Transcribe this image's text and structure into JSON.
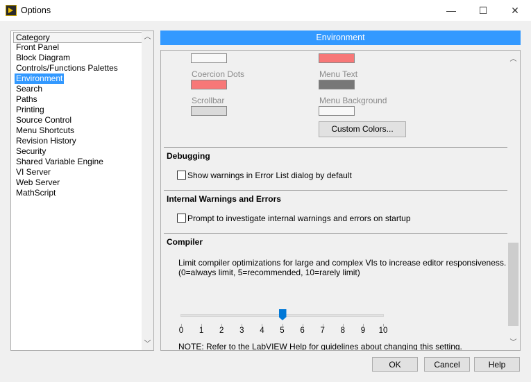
{
  "window": {
    "title": "Options",
    "minimize": "—",
    "maximize": "☐",
    "close": "✕"
  },
  "sidebar": {
    "header": "Category",
    "selected": "Environment",
    "items": [
      "Front Panel",
      "Block Diagram",
      "Controls/Functions Palettes",
      "Environment",
      "Search",
      "Paths",
      "Printing",
      "Source Control",
      "Menu Shortcuts",
      "Revision History",
      "Security",
      "Shared Variable Engine",
      "VI Server",
      "Web Server",
      "MathScript"
    ]
  },
  "panel": {
    "title": "Environment",
    "colors": {
      "coercion_dots": "Coercion Dots",
      "menu_text": "Menu Text",
      "scrollbar": "Scrollbar",
      "menu_background": "Menu Background",
      "custom_colors_button": "Custom Colors...",
      "swatches": {
        "top_left": "#f8f8f8",
        "top_right": "#f77777",
        "coercion_dots": "#f77777",
        "menu_text": "#777777",
        "scrollbar": "#dadada",
        "menu_background": "#f8f8f8"
      }
    },
    "debugging": {
      "heading": "Debugging",
      "checkbox": "Show warnings in Error List dialog by default",
      "checked": false
    },
    "internal": {
      "heading": "Internal Warnings and Errors",
      "checkbox": "Prompt to investigate internal warnings and errors on startup",
      "checked": false
    },
    "compiler": {
      "heading": "Compiler",
      "desc1": "Limit compiler optimizations for large and complex VIs to increase editor responsiveness.",
      "desc2": "(0=always limit, 5=recommended, 10=rarely limit)",
      "slider_min": 0,
      "slider_max": 10,
      "slider_value": 5,
      "ticks": [
        "0",
        "1",
        "2",
        "3",
        "4",
        "5",
        "6",
        "7",
        "8",
        "9",
        "10"
      ],
      "note": "NOTE: Refer to the LabVIEW Help for guidelines about changing this setting."
    }
  },
  "buttons": {
    "ok": "OK",
    "cancel": "Cancel",
    "help": "Help"
  },
  "accent": "#3399ff"
}
